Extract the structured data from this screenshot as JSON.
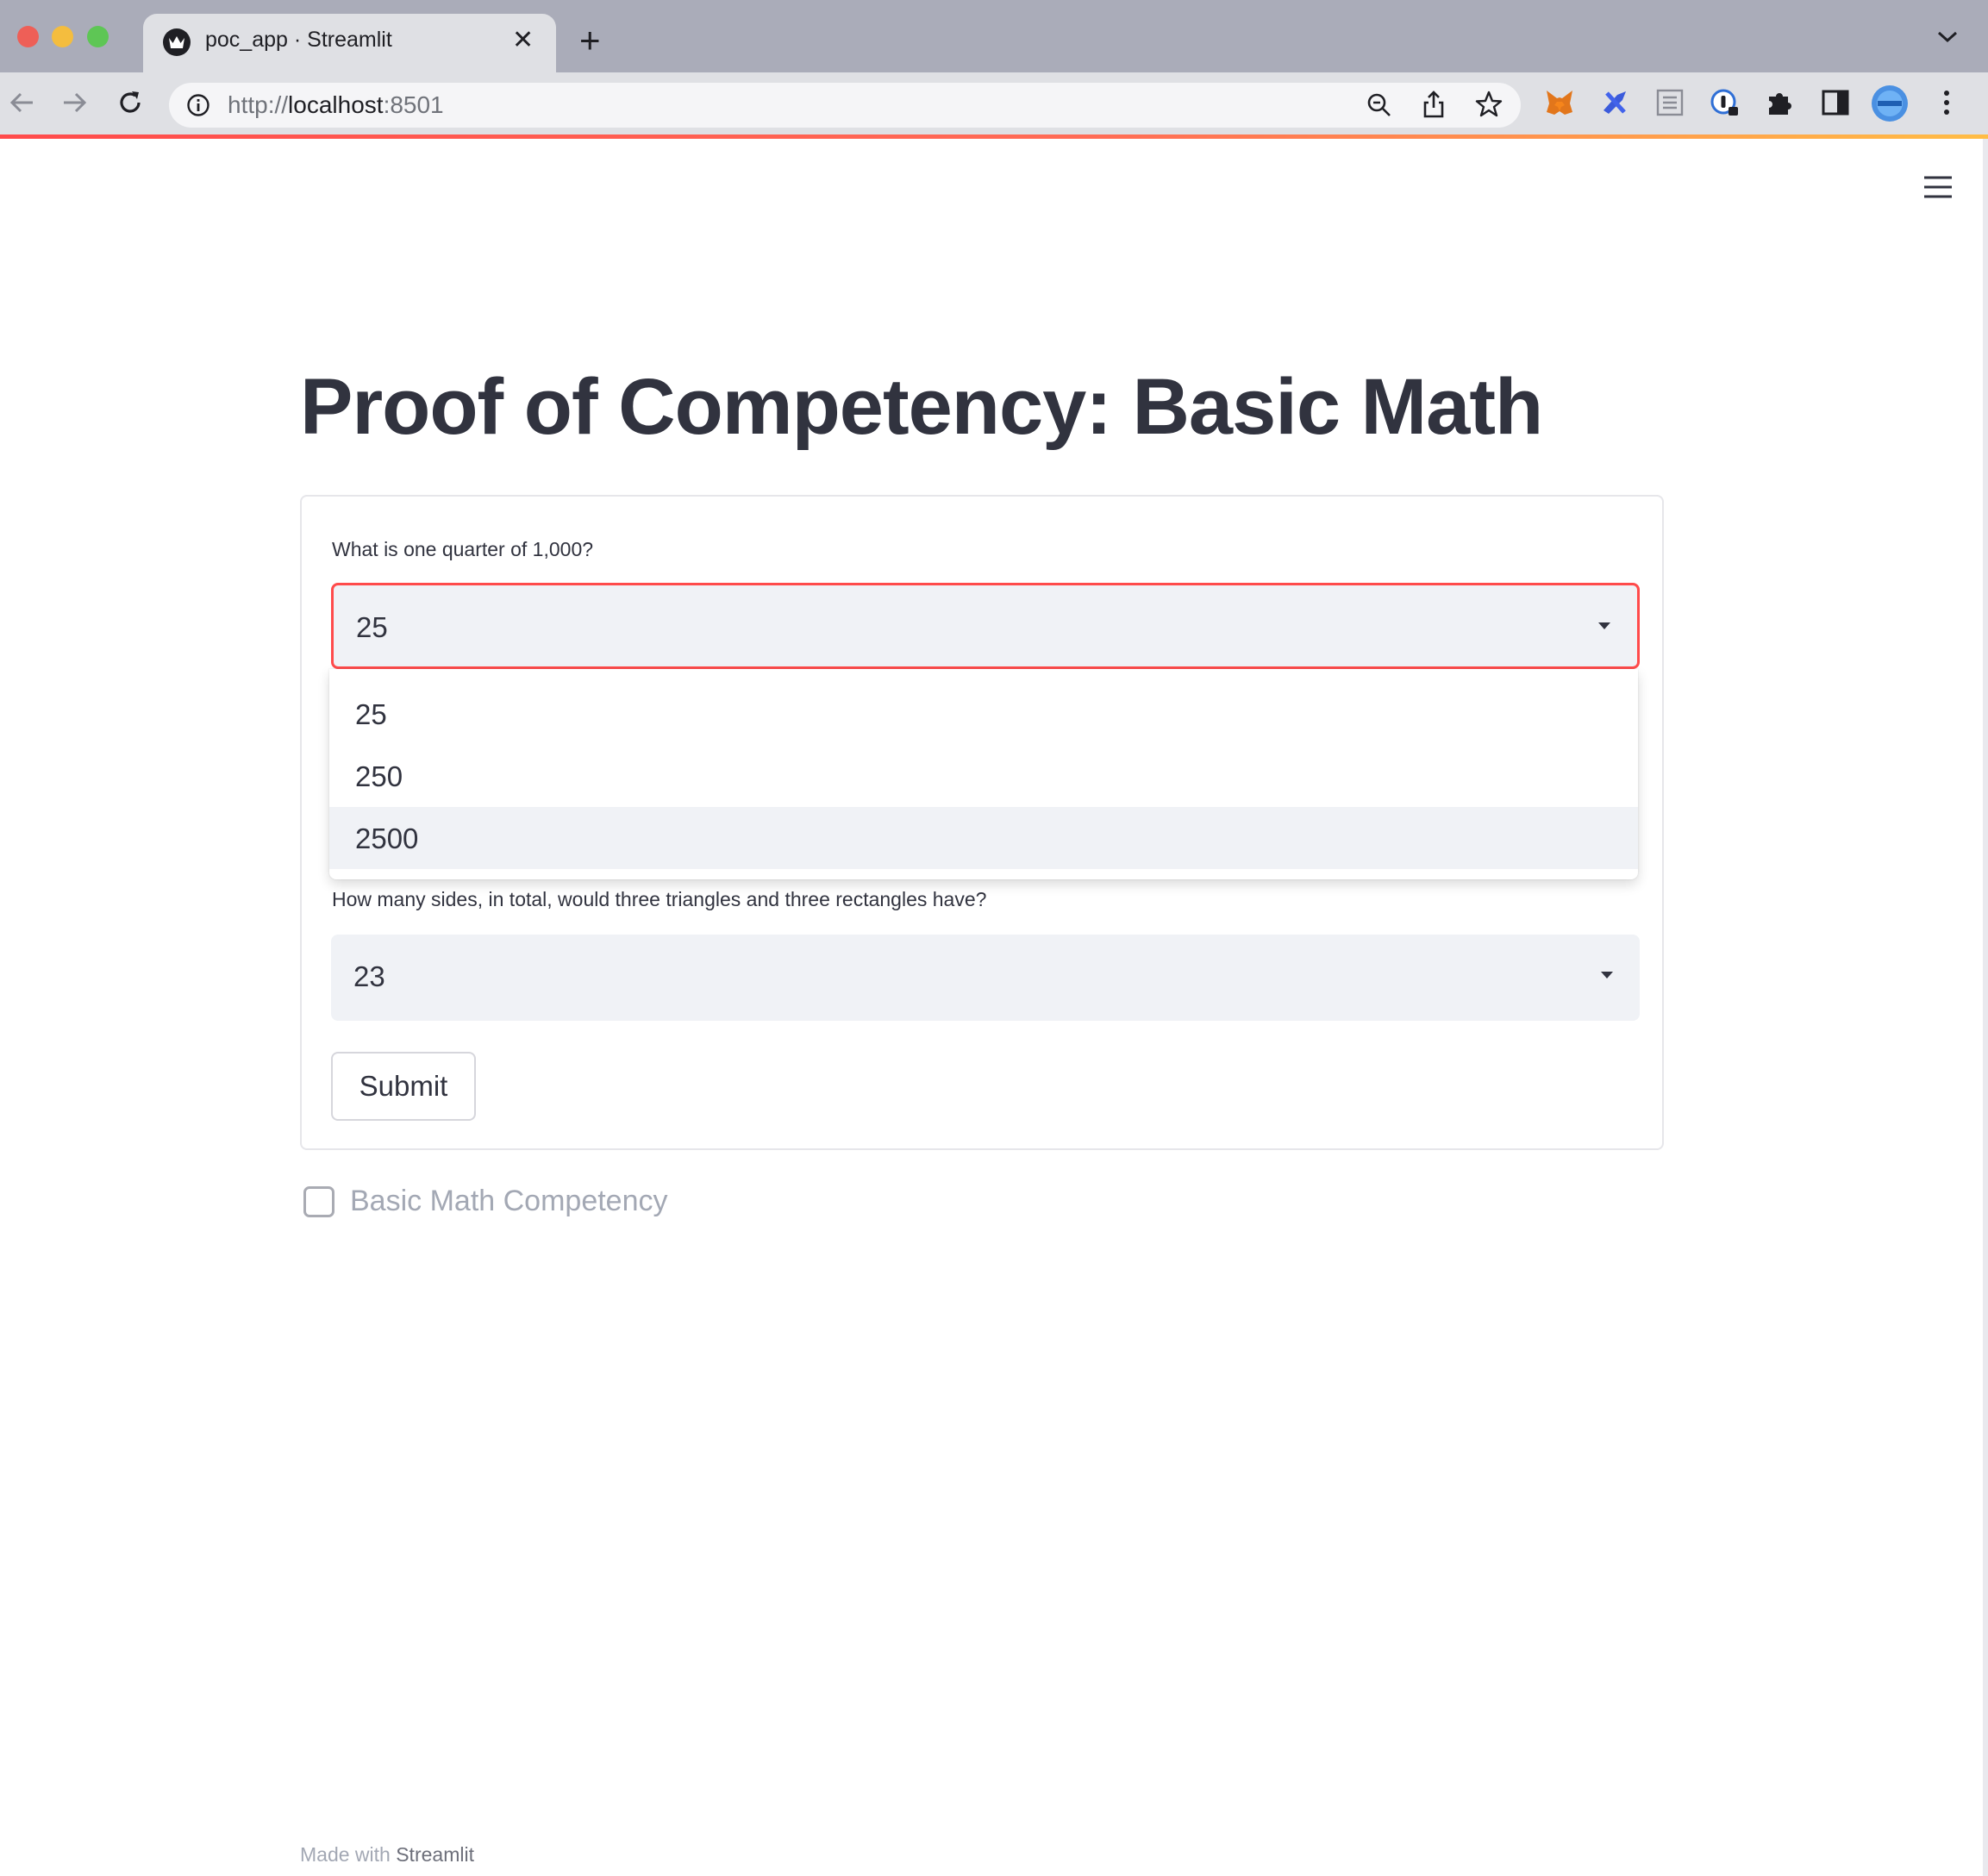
{
  "browser": {
    "tab_title": "poc_app · Streamlit",
    "close_glyph": "✕",
    "new_tab_glyph": "+",
    "url_scheme": "http://",
    "url_host": "localhost",
    "url_port": ":8501"
  },
  "app": {
    "title": "Proof of Competency: Basic Math",
    "accent_color": "#ff4b4b",
    "question1": {
      "label": "What is one quarter of 1,000?",
      "selected": "25",
      "options": [
        "25",
        "250",
        "2500"
      ],
      "highlighted_option": "2500"
    },
    "question2": {
      "label": "How many sides, in total, would three triangles and three rectangles have?",
      "selected": "23"
    },
    "submit_label": "Submit",
    "checkbox": {
      "label": "Basic Math Competency",
      "checked": false
    },
    "footer": {
      "prefix": "Made with",
      "brand": "Streamlit"
    }
  },
  "icons": [
    "back-arrow-icon",
    "forward-arrow-icon",
    "reload-icon",
    "site-info-icon",
    "zoom-out-icon",
    "share-icon",
    "bookmark-star-icon",
    "metamask-icon",
    "extension-icon",
    "reader-icon",
    "password-icon",
    "puzzle-icon",
    "sidebar-icon",
    "profile-avatar",
    "kebab-menu-icon",
    "hamburger-menu-icon"
  ]
}
